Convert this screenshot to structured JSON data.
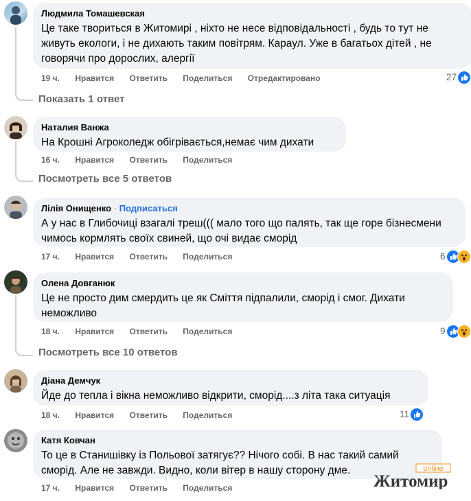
{
  "comments": [
    {
      "author": "Людмила Томашевская",
      "text": "Це таке твориться в Житомирі , ніхто не несе відповідальності , будь то тут не живуть екологи, і не дихають таким повітрям. Караул. Уже в багатьох дітей , не говорячи про дорослих, алергії",
      "time": "19 ч.",
      "like": "Нравится",
      "reply": "Ответить",
      "share": "Поделиться",
      "edited": "Отредактировано",
      "reactions": "27"
    },
    {
      "author": "Наталия Ванжа",
      "text": "На Крошні Агроколедж обігрівається,немає чим дихати",
      "time": "16 ч.",
      "like": "Нравится",
      "reply": "Ответить",
      "share": "Поделиться"
    },
    {
      "author": "Лілія Онищенко",
      "subscribe": "Подписаться",
      "separator": "·",
      "text": "А у нас в Глибочиці взагалі треш((( мало того що палять, так ще горе бізнесмени чимось кормлять своїх свиней, що очі видає сморід",
      "time": "17 ч.",
      "like": "Нравится",
      "reply": "Ответить",
      "share": "Поделиться",
      "reactions": "6"
    },
    {
      "author": "Олена Довганюк",
      "text": "Це не просто дим смердить це як Сміття підпалили, сморід і смог. Дихати неможливо",
      "time": "18 ч.",
      "like": "Нравится",
      "reply": "Ответить",
      "share": "Поделиться",
      "reactions": "9"
    },
    {
      "author": "Діана Демчук",
      "text": "Йде до тепла і вікна неможливо відкрити, сморід....з літа така ситуація",
      "time": "18 ч.",
      "like": "Нравится",
      "reply": "Ответить",
      "share": "Поделиться",
      "reactions": "11"
    },
    {
      "author": "Катя Ковчан",
      "text": "То це в Станишівку із Польової затягує?? Нічого собі. В нас такий самий сморід. Але не завжди. Видно, коли вітер в нашу сторону дме.",
      "time": "17 ч.",
      "like": "Нравится",
      "reply": "Ответить",
      "share": "Поделиться"
    }
  ],
  "replies": {
    "r1": "Показать 1 ответ",
    "r2": "Посмотреть все 5 ответов",
    "r3": "Посмотреть все 10 ответов"
  },
  "watermark": {
    "online": "online",
    "name": "Житомир"
  },
  "colors": {
    "bubble": "#f0f2f5",
    "meta": "#65676b",
    "link": "#216fdb",
    "like": "#1877f2",
    "wow": "#f7b125"
  },
  "icons": [
    "like-reaction-icon",
    "wow-reaction-icon"
  ]
}
